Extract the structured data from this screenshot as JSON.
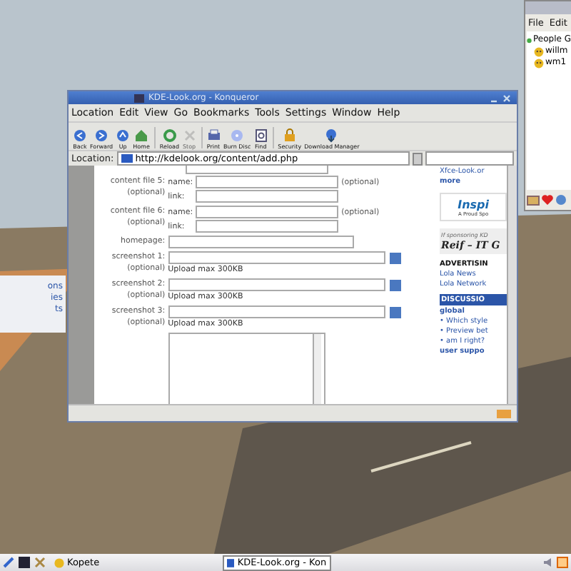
{
  "left_window": {
    "lines": [
      "ons",
      "ies",
      "ts"
    ]
  },
  "kopete": {
    "menu": [
      "File",
      "Edit"
    ],
    "contacts": [
      {
        "label": "People G",
        "expanded": true,
        "children": [
          {
            "label": "willm"
          },
          {
            "label": "wm1"
          }
        ]
      }
    ]
  },
  "browser": {
    "title": "KDE-Look.org - Konqueror",
    "menu": [
      "Location",
      "Edit",
      "View",
      "Go",
      "Bookmarks",
      "Tools",
      "Settings",
      "Window",
      "Help"
    ],
    "toolbar": [
      {
        "label": "Back",
        "kind": "back",
        "disabled": false
      },
      {
        "label": "Forward",
        "kind": "forward",
        "disabled": false
      },
      {
        "label": "Up",
        "kind": "up",
        "disabled": false
      },
      {
        "label": "Home",
        "kind": "home",
        "disabled": false
      },
      {
        "label": "Reload",
        "kind": "reload",
        "disabled": false
      },
      {
        "label": "Stop",
        "kind": "stop",
        "disabled": true
      },
      {
        "label": "Print",
        "kind": "print",
        "disabled": false
      },
      {
        "label": "Burn Disc",
        "kind": "disc",
        "disabled": false
      },
      {
        "label": "Find",
        "kind": "find",
        "disabled": false
      },
      {
        "label": "Security",
        "kind": "lock",
        "disabled": false
      },
      {
        "label": "Download Manager",
        "kind": "download",
        "disabled": false
      }
    ],
    "location": {
      "label": "Location:",
      "value": "http://kdelook.org/content/add.php"
    },
    "form": [
      {
        "kind": "partial"
      },
      {
        "kind": "file",
        "label": "content file 5:",
        "sublabel": "(optional)",
        "name": "name:",
        "link": "link:",
        "note": "(optional)"
      },
      {
        "kind": "file",
        "label": "content file 6:",
        "sublabel": "(optional)",
        "name": "name:",
        "link": "link:",
        "note": "(optional)"
      },
      {
        "kind": "text",
        "label": "homepage:"
      },
      {
        "kind": "upload",
        "label": "screenshot 1:",
        "sublabel": "(optional)",
        "note": "Upload max 300KB"
      },
      {
        "kind": "upload",
        "label": "screenshot 2:",
        "sublabel": "(optional)",
        "note": "Upload max 300KB"
      },
      {
        "kind": "upload",
        "label": "screenshot 3:",
        "sublabel": "(optional)",
        "note": "Upload max 300KB"
      },
      {
        "kind": "textarea"
      }
    ],
    "sidebar": [
      {
        "kind": "link",
        "text": "Xfce-Look.or"
      },
      {
        "kind": "more",
        "text": "more"
      },
      {
        "kind": "banner",
        "text": "Inspi",
        "sub": "A Proud Spo"
      },
      {
        "kind": "sponsor",
        "text": "If sponsoring KD",
        "sub": "Reif – IT G"
      },
      {
        "kind": "heading",
        "text": "ADVERTISIN"
      },
      {
        "kind": "link",
        "text": "Lola News"
      },
      {
        "kind": "link",
        "text": "Lola Network"
      },
      {
        "kind": "header",
        "text": "DISCUSSIO"
      },
      {
        "kind": "section",
        "text": "global"
      },
      {
        "kind": "bullet",
        "text": "• Which style"
      },
      {
        "kind": "bullet",
        "text": "• Preview bet"
      },
      {
        "kind": "bullet",
        "text": "• am I right?"
      },
      {
        "kind": "section",
        "text": "user suppo"
      }
    ]
  },
  "taskbar": {
    "tasks": [
      {
        "label": "Kopete",
        "selected": false
      },
      {
        "label": "KDE-Look.org - Kon",
        "selected": true
      }
    ]
  }
}
